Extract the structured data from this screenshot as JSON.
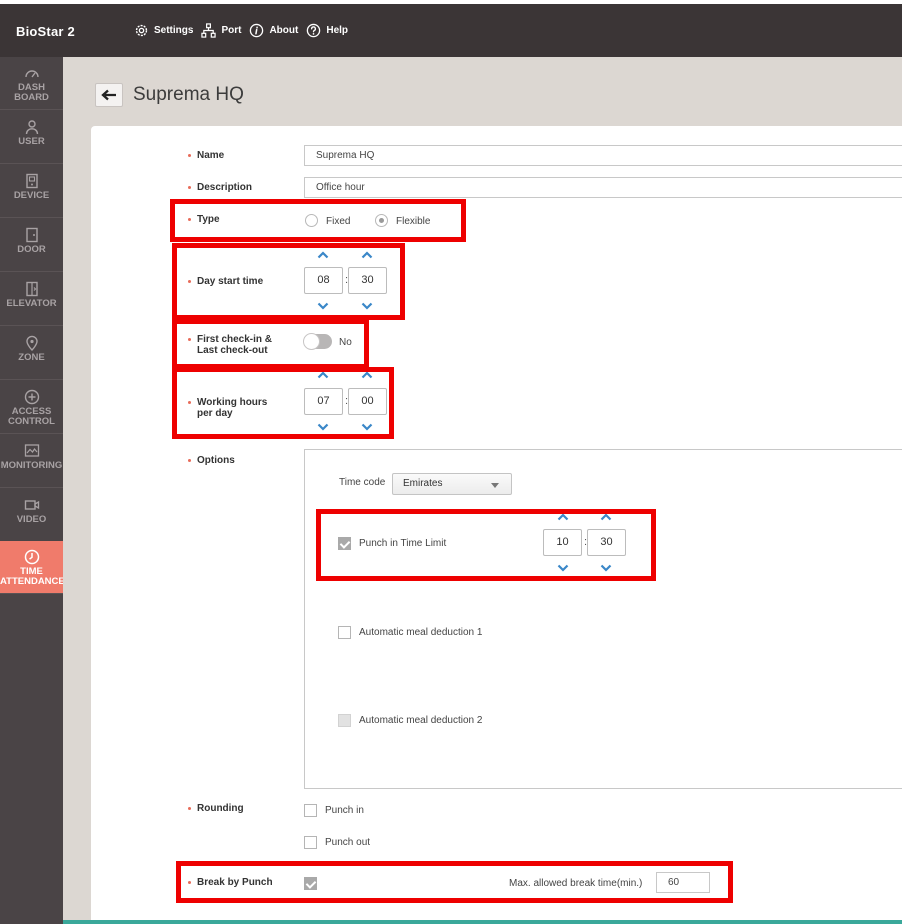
{
  "app": {
    "brand": "BioStar 2"
  },
  "topnav": [
    {
      "label": "Settings",
      "icon": "gear-icon"
    },
    {
      "label": "Port",
      "icon": "network-icon"
    },
    {
      "label": "About",
      "icon": "info-icon"
    },
    {
      "label": "Help",
      "icon": "help-icon"
    }
  ],
  "sidebar": {
    "items": [
      {
        "label1": "DASH",
        "label2": "BOARD",
        "icon": "dashboard-icon"
      },
      {
        "label1": "USER",
        "label2": "",
        "icon": "user-icon"
      },
      {
        "label1": "DEVICE",
        "label2": "",
        "icon": "device-icon"
      },
      {
        "label1": "DOOR",
        "label2": "",
        "icon": "door-icon"
      },
      {
        "label1": "ELEVATOR",
        "label2": "",
        "icon": "elevator-icon"
      },
      {
        "label1": "ZONE",
        "label2": "",
        "icon": "zone-icon"
      },
      {
        "label1": "ACCESS",
        "label2": "CONTROL",
        "icon": "access-control-icon"
      },
      {
        "label1": "MONITORING",
        "label2": "",
        "icon": "monitoring-icon"
      },
      {
        "label1": "VIDEO",
        "label2": "",
        "icon": "video-icon"
      },
      {
        "label1": "TIME",
        "label2": "ATTENDANCE",
        "icon": "clock-icon",
        "active": true
      }
    ]
  },
  "page": {
    "title": "Suprema HQ"
  },
  "form": {
    "name": {
      "label": "Name",
      "value": "Suprema HQ"
    },
    "description": {
      "label": "Description",
      "value": "Office hour"
    },
    "type": {
      "label": "Type",
      "options": [
        "Fixed",
        "Flexible"
      ],
      "selected": "Flexible"
    },
    "day_start": {
      "label": "Day start time",
      "hour": "08",
      "minute": "30"
    },
    "first_last": {
      "label1": "First check-in &",
      "label2": "Last check-out",
      "toggle_text": "No"
    },
    "working_hours": {
      "label1": "Working hours",
      "label2": "per day",
      "hour": "07",
      "minute": "00"
    },
    "options": {
      "label": "Options",
      "time_code_label": "Time code",
      "time_code_value": "Emirates",
      "punch_limit": {
        "label": "Punch in Time Limit",
        "checked": true,
        "hour": "10",
        "minute": "30"
      },
      "meal1": {
        "label": "Automatic meal deduction 1",
        "checked": false
      },
      "meal2": {
        "label": "Automatic meal deduction 2",
        "checked": false,
        "disabled": true
      }
    },
    "rounding": {
      "label": "Rounding",
      "punch_in": "Punch in",
      "punch_out": "Punch out"
    },
    "break_by_punch": {
      "label": "Break by Punch",
      "checked": true,
      "max_label": "Max. allowed break time(min.)",
      "max_value": "60"
    }
  },
  "colors": {
    "accent": "#f07b6b",
    "highlight": "#ee0000",
    "chevron": "#3a87c8",
    "sidebar": "#4a4446",
    "topbar": "#3b3536"
  }
}
